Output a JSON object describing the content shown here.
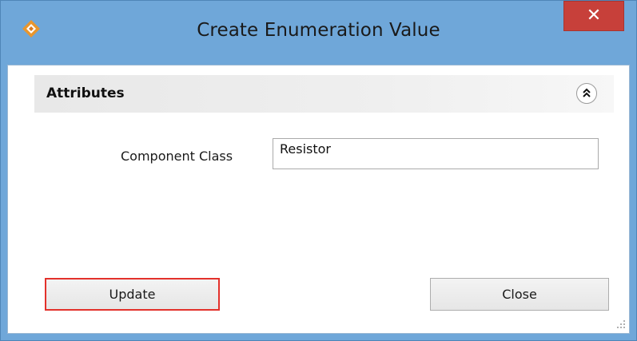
{
  "window": {
    "title": "Create Enumeration Value",
    "close_symbol": "✕",
    "icon": "app-logo-icon"
  },
  "section": {
    "title": "Attributes",
    "collapse_icon": "double-chevron-up-icon"
  },
  "form": {
    "component_class_label": "Component Class",
    "component_class_value": "Resistor"
  },
  "buttons": {
    "update_label": "Update",
    "close_label": "Close"
  },
  "colors": {
    "titlebar": "#6fa7d9",
    "close_button": "#c7403a",
    "highlight_border": "#e3312b",
    "icon_orange": "#e8962e"
  }
}
